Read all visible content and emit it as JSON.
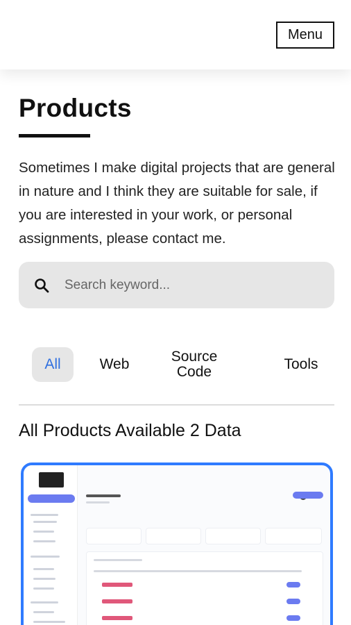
{
  "header": {
    "menu_label": "Menu"
  },
  "page": {
    "title": "Products",
    "intro": "Sometimes I make digital projects that are general in nature and I think they are suitable for sale, if you are interested in your work, or personal assignments, please contact me."
  },
  "search": {
    "placeholder": "Search keyword...",
    "value": ""
  },
  "tabs": [
    {
      "label": "All",
      "active": true
    },
    {
      "label": "Web",
      "active": false
    },
    {
      "label": "Source Code",
      "active": false
    },
    {
      "label": "Tools",
      "active": false
    }
  ],
  "section": {
    "title": "All Products Available 2 Data"
  },
  "colors": {
    "accent": "#2f6fe0",
    "card_border": "#2f7bff",
    "tag_pink": "#e0587a",
    "pill_purple": "#6b7bf0"
  },
  "icons": {
    "search": "search-icon"
  }
}
